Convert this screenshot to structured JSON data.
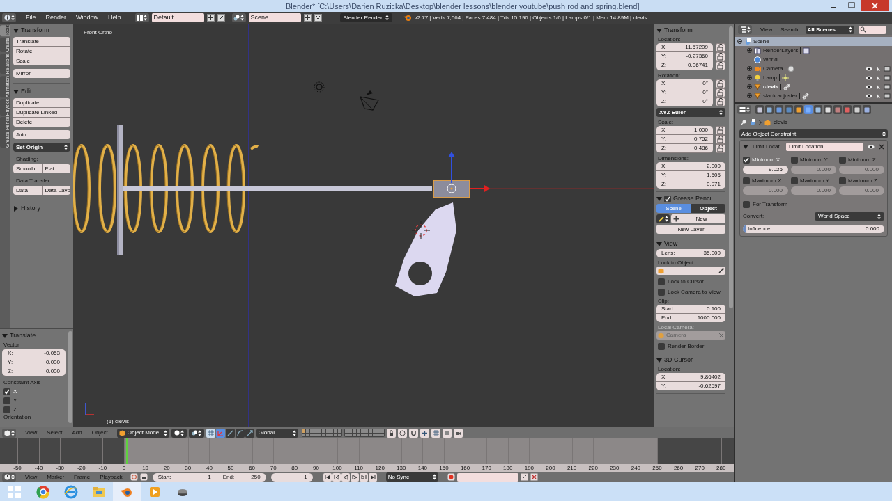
{
  "title_bar": {
    "title": "Blender* [C:\\Users\\Darien Ruzicka\\Desktop\\blender lessons\\blender youtube\\push rod and spring.blend]"
  },
  "info_header": {
    "menus": [
      "File",
      "Render",
      "Window",
      "Help"
    ],
    "layout": "Default",
    "scene": "Scene",
    "engine": "Blender Render",
    "stats": "v2.77 | Verts:7,664 | Faces:7,484 | Tris:15,196 | Objects:1/6 | Lamps:0/1 | Mem:14.89M | clevis"
  },
  "tool_tabs": [
    {
      "label": "Tools",
      "selected": true
    },
    {
      "label": "Create",
      "selected": false
    },
    {
      "label": "Relations",
      "selected": false
    },
    {
      "label": "Animation",
      "selected": false
    },
    {
      "label": "Physics",
      "selected": false
    },
    {
      "label": "Grease Pencil",
      "selected": false
    }
  ],
  "tool_shelf": [
    {
      "title": "Transform",
      "expanded": true,
      "items": [
        {
          "kind": "stack",
          "labels": [
            "Translate",
            "Rotate",
            "Scale"
          ]
        },
        {
          "kind": "stack",
          "labels": [
            "Mirror"
          ]
        }
      ]
    },
    {
      "title": "Edit",
      "expanded": true,
      "items": [
        {
          "kind": "stack",
          "labels": [
            "Duplicate",
            "Duplicate Linked",
            "Delete"
          ]
        },
        {
          "kind": "stack",
          "labels": [
            "Join"
          ]
        },
        {
          "kind": "dropdown",
          "labels": [
            "Set Origin"
          ]
        },
        {
          "kind": "label",
          "labels": [
            "Shading:"
          ]
        },
        {
          "kind": "row",
          "labels": [
            "Smooth",
            "Flat"
          ]
        },
        {
          "kind": "label",
          "labels": [
            "Data Transfer:"
          ]
        },
        {
          "kind": "row",
          "labels": [
            "Data",
            "Data Layo"
          ]
        }
      ]
    },
    {
      "title": "History",
      "expanded": false
    }
  ],
  "operator_panel": {
    "title": "Translate",
    "expanded": true,
    "vector_label": "Vector",
    "fields": [
      {
        "axis": "X:",
        "value": "-0.053"
      },
      {
        "axis": "Y:",
        "value": "0.000"
      },
      {
        "axis": "Z:",
        "value": "0.000"
      }
    ],
    "constraint_label": "Constraint Axis",
    "axes": [
      {
        "label": "X",
        "checked": true
      },
      {
        "label": "Y",
        "checked": false
      },
      {
        "label": "Z",
        "checked": false
      }
    ],
    "orientation_label": "Orientation"
  },
  "viewport": {
    "view_name": "Front Ortho",
    "object_info": "(1) clevis"
  },
  "n_panel": [
    {
      "title": "Transform",
      "expanded": true,
      "rows": [
        {
          "kind": "label",
          "text": "Location:",
          "disabled": false
        },
        {
          "kind": "vector",
          "locks": true,
          "fields": [
            {
              "axis": "X:",
              "value": "11.57209"
            },
            {
              "axis": "Y:",
              "value": "-0.27360"
            },
            {
              "axis": "Z:",
              "value": "0.06741"
            }
          ]
        },
        {
          "kind": "label",
          "text": "Rotation:",
          "disabled": false
        },
        {
          "kind": "vector",
          "locks": true,
          "fields": [
            {
              "axis": "X:",
              "value": "0°"
            },
            {
              "axis": "Y:",
              "value": "0°"
            },
            {
              "axis": "Z:",
              "value": "0°"
            }
          ]
        },
        {
          "kind": "dropdown",
          "text": "XYZ Euler"
        },
        {
          "kind": "label",
          "text": "Scale:",
          "disabled": false
        },
        {
          "kind": "vector",
          "locks": true,
          "fields": [
            {
              "axis": "X:",
              "value": "1.000"
            },
            {
              "axis": "Y:",
              "value": "0.752"
            },
            {
              "axis": "Z:",
              "value": "0.486"
            }
          ]
        },
        {
          "kind": "label",
          "text": "Dimensions:",
          "disabled": false
        },
        {
          "kind": "vector",
          "locks": false,
          "fields": [
            {
              "axis": "X:",
              "value": "2.000"
            },
            {
              "axis": "Y:",
              "value": "1.505"
            },
            {
              "axis": "Z:",
              "value": "0.971"
            }
          ]
        }
      ]
    },
    {
      "title": "Grease Pencil",
      "expanded": true,
      "checked": true,
      "rows": [
        {
          "kind": "tabs",
          "items": [
            {
              "label": "Scene",
              "selected": true
            },
            {
              "label": "Object",
              "selected": false
            }
          ]
        },
        {
          "kind": "new",
          "text": "New"
        },
        {
          "kind": "button",
          "text": "New Layer"
        }
      ]
    },
    {
      "title": "View",
      "expanded": true,
      "rows": [
        {
          "kind": "vector",
          "locks": false,
          "fields": [
            {
              "axis": "Lens:",
              "value": "35.000"
            }
          ]
        },
        {
          "kind": "label",
          "text": "Lock to Object:",
          "disabled": false
        },
        {
          "kind": "picker"
        },
        {
          "kind": "checkbox",
          "text": "Lock to Cursor",
          "checked": false
        },
        {
          "kind": "checkbox",
          "text": "Lock Camera to View",
          "checked": false
        },
        {
          "kind": "label",
          "text": "Clip:",
          "disabled": false
        },
        {
          "kind": "vector",
          "locks": false,
          "fields": [
            {
              "axis": "Start:",
              "value": "0.100"
            },
            {
              "axis": "End:",
              "value": "1000.000"
            }
          ]
        },
        {
          "kind": "label",
          "text": "Local Camera:",
          "disabled": true
        },
        {
          "kind": "object_field",
          "text": "Camera",
          "disabled": true
        },
        {
          "kind": "checkbox",
          "text": "Render Border",
          "checked": false
        }
      ]
    },
    {
      "title": "3D Cursor",
      "expanded": true,
      "rows": [
        {
          "kind": "label",
          "text": "Location:",
          "disabled": false
        },
        {
          "kind": "vector",
          "locks": false,
          "fields": [
            {
              "axis": "X:",
              "value": "9.86402"
            },
            {
              "axis": "Y:",
              "value": "-0.62597"
            }
          ]
        }
      ]
    }
  ],
  "outliner": {
    "menus": [
      "View",
      "Search"
    ],
    "filter": "All Scenes",
    "tree": [
      {
        "label": "Scene",
        "kind": "scene",
        "selected": true,
        "active": false,
        "expanded": true,
        "children": [
          {
            "label": "RenderLayers",
            "kind": "renderlayers",
            "selected": false,
            "active": false,
            "expanded": false
          },
          {
            "label": "World",
            "kind": "world",
            "selected": false,
            "active": false
          },
          {
            "label": "Camera",
            "kind": "camera",
            "selected": false,
            "active": false,
            "expanded": false
          },
          {
            "label": "Lamp",
            "kind": "lamp",
            "selected": false,
            "active": false,
            "expanded": false
          },
          {
            "label": "clevis",
            "kind": "mesh",
            "selected": false,
            "active": true,
            "expanded": false
          },
          {
            "label": "slack adjuster",
            "kind": "mesh",
            "selected": false,
            "active": false,
            "expanded": false
          }
        ]
      }
    ]
  },
  "properties": {
    "context_tabs": [
      {
        "selected": false
      },
      {
        "selected": false
      },
      {
        "selected": false
      },
      {
        "selected": false
      },
      {
        "selected": false
      },
      {
        "selected": true
      },
      {
        "selected": false
      },
      {
        "selected": false
      },
      {
        "selected": false
      },
      {
        "selected": false
      },
      {
        "selected": false
      },
      {
        "selected": false
      }
    ],
    "breadcrumb": "clevis",
    "add_constraint": "Add Object Constraint",
    "constraint": {
      "type_label": "Limit Locati",
      "name": "Limit Location",
      "expanded": true,
      "limits": [
        {
          "label": "Minimum X",
          "checked": true,
          "value": "9.025"
        },
        {
          "label": "Minimum Y",
          "checked": false,
          "value": "0.000"
        },
        {
          "label": "Minimum Z",
          "checked": false,
          "value": "0.000"
        },
        {
          "label": "Maximum X",
          "checked": false,
          "value": "0.000"
        },
        {
          "label": "Maximum Y",
          "checked": false,
          "value": "0.000"
        },
        {
          "label": "Maximum Z",
          "checked": false,
          "value": "0.000"
        }
      ],
      "for_transform": {
        "label": "For Transform",
        "checked": false
      },
      "convert_label": "Convert:",
      "convert_value": "World Space",
      "influence_label": "Influence:",
      "influence_value": "0.000",
      "level": 0
    }
  },
  "view_header": {
    "menus": [
      "View",
      "Select",
      "Add",
      "Object"
    ],
    "mode": "Object Mode",
    "orientation": "Global"
  },
  "timeline": {
    "ruler": [
      "-50",
      "-40",
      "-30",
      "-20",
      "-10",
      "0",
      "10",
      "20",
      "30",
      "40",
      "50",
      "60",
      "70",
      "80",
      "90",
      "100",
      "110",
      "120",
      "130",
      "140",
      "150",
      "160",
      "170",
      "180",
      "190",
      "200",
      "210",
      "220",
      "230",
      "240",
      "250",
      "260",
      "270",
      "280"
    ],
    "menus": [
      "View",
      "Marker",
      "Frame",
      "Playback"
    ],
    "start_label": "Start:",
    "start": "1",
    "end_label": "End:",
    "end": "250",
    "current": "1",
    "sync": "No Sync"
  }
}
